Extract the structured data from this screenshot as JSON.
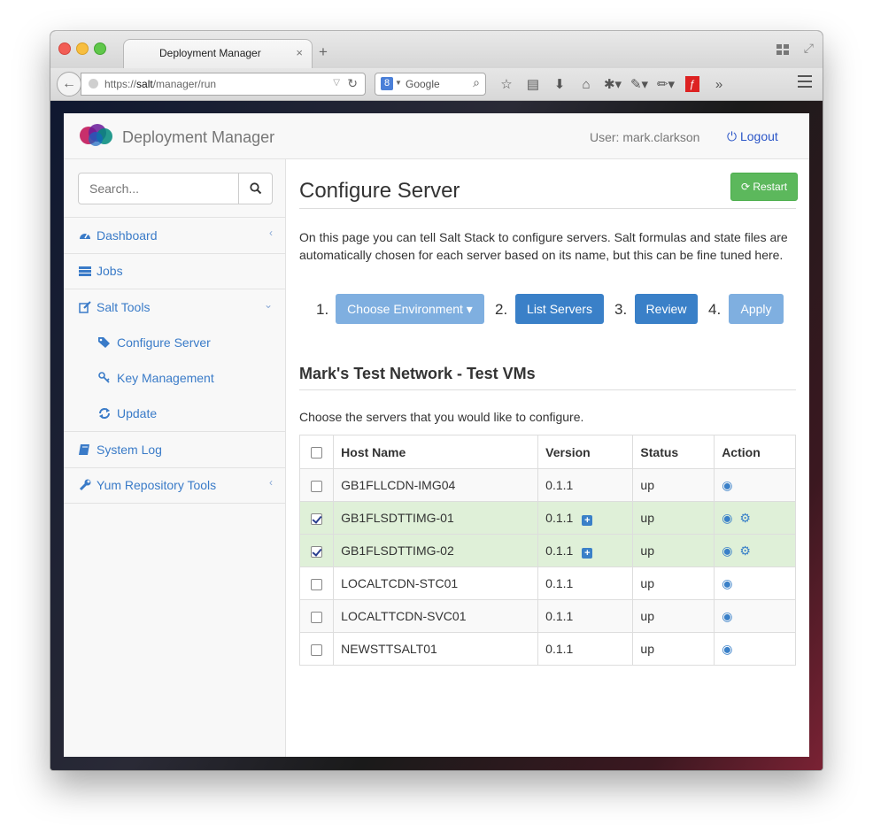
{
  "browser": {
    "tab_title": "Deployment Manager",
    "tab_close": "×",
    "new_tab": "+",
    "back": "←",
    "url_prefix": "https://",
    "url_host": "salt",
    "url_path": "/manager/run",
    "search_engine_icon": "8",
    "search_placeholder": "Google",
    "toolbar_icons": [
      "star-icon",
      "reading-list-icon",
      "download-icon",
      "home-icon",
      "bug-icon",
      "eyedropper-icon",
      "pencil-icon",
      "flash-icon",
      "overflow-icon"
    ]
  },
  "app": {
    "brand": "Deployment Manager",
    "user": "User: mark.clarkson",
    "logout": "Logout",
    "accent_color": "#3a80c8",
    "success_color": "#5cb85c"
  },
  "sidebar": {
    "search_placeholder": "Search...",
    "items": [
      {
        "label": "Dashboard",
        "icon": "dashboard-icon",
        "chevron": "‹"
      },
      {
        "label": "Jobs",
        "icon": "tasks-icon"
      },
      {
        "label": "Salt Tools",
        "icon": "edit-icon",
        "chevron": "⌄"
      },
      {
        "label": "System Log",
        "icon": "book-icon"
      },
      {
        "label": "Yum Repository Tools",
        "icon": "wrench-icon",
        "chevron": "‹"
      }
    ],
    "sub_items": [
      {
        "label": "Configure Server",
        "icon": "tags-icon"
      },
      {
        "label": "Key Management",
        "icon": "key-icon"
      },
      {
        "label": "Update",
        "icon": "refresh-icon"
      }
    ]
  },
  "main": {
    "title": "Configure Server",
    "restart_label": "Restart",
    "intro": "On this page you can tell Salt Stack to configure servers. Salt formulas and state files are automatically chosen for each server based on its name, but this can be fine tuned here.",
    "steps": [
      {
        "num": "1.",
        "label": "Choose Environment ▾"
      },
      {
        "num": "2.",
        "label": "List Servers"
      },
      {
        "num": "3.",
        "label": "Review"
      },
      {
        "num": "4.",
        "label": "Apply"
      }
    ],
    "network_title": "Mark's Test Network - Test VMs",
    "choose_text": "Choose the servers that you would like to configure.",
    "table": {
      "headers": [
        "Host Name",
        "Version",
        "Status",
        "Action"
      ],
      "rows": [
        {
          "host": "GB1FLLCDN-IMG04",
          "version": "0.1.1",
          "status": "up",
          "checked": false,
          "selected": false,
          "expandable": false,
          "configurable": false
        },
        {
          "host": "GB1FLSDTTIMG-01",
          "version": "0.1.1",
          "status": "up",
          "checked": true,
          "selected": true,
          "expandable": true,
          "configurable": true
        },
        {
          "host": "GB1FLSDTTIMG-02",
          "version": "0.1.1",
          "status": "up",
          "checked": true,
          "selected": true,
          "expandable": true,
          "configurable": true
        },
        {
          "host": "LOCALTCDN-STC01",
          "version": "0.1.1",
          "status": "up",
          "checked": false,
          "selected": false,
          "expandable": false,
          "configurable": false
        },
        {
          "host": "LOCALTTCDN-SVC01",
          "version": "0.1.1",
          "status": "up",
          "checked": false,
          "selected": false,
          "expandable": false,
          "configurable": false
        },
        {
          "host": "NEWSTTSALT01",
          "version": "0.1.1",
          "status": "up",
          "checked": false,
          "selected": false,
          "expandable": false,
          "configurable": false
        }
      ]
    }
  }
}
